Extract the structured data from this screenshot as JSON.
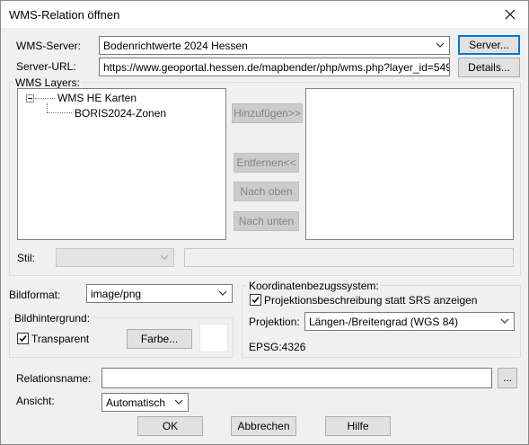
{
  "window": {
    "title": "WMS-Relation öffnen"
  },
  "server": {
    "label": "WMS-Server:",
    "selected": "Bodenrichtwerte 2024 Hessen",
    "button": "Server..."
  },
  "url": {
    "label": "Server-URL:",
    "value": "https://www.geoportal.hessen.de/mapbender/php/wms.php?layer_id=54931&F",
    "button": "Details..."
  },
  "layers": {
    "group_title": "WMS Layers:",
    "tree": [
      {
        "label": "WMS HE Karten",
        "expander": "−"
      },
      {
        "label": "BORIS2024-Zonen"
      }
    ],
    "buttons": {
      "add": "Hinzufügen>>",
      "remove": "Entfernen<<",
      "up": "Nach oben",
      "down": "Nach unten"
    },
    "style_label": "Stil:"
  },
  "format": {
    "label": "Bildformat:",
    "selected": "image/png"
  },
  "background": {
    "group_title": "Bildhintergrund:",
    "transparent_label": "Transparent",
    "transparent_checked": true,
    "color_button": "Farbe..."
  },
  "crs": {
    "group_title": "Koordinatenbezugssystem:",
    "proj_desc_label": "Projektionsbeschreibung statt SRS anzeigen",
    "proj_desc_checked": true,
    "projection_label": "Projektion:",
    "projection_selected": "Längen-/Breitengrad (WGS 84)",
    "epsg": "EPSG:4326"
  },
  "relation": {
    "name_label": "Relationsname:",
    "name_value": "",
    "browse_button": "...",
    "view_label": "Ansicht:",
    "view_selected": "Automatisch"
  },
  "footer": {
    "ok": "OK",
    "cancel": "Abbrechen",
    "help": "Hilfe"
  }
}
